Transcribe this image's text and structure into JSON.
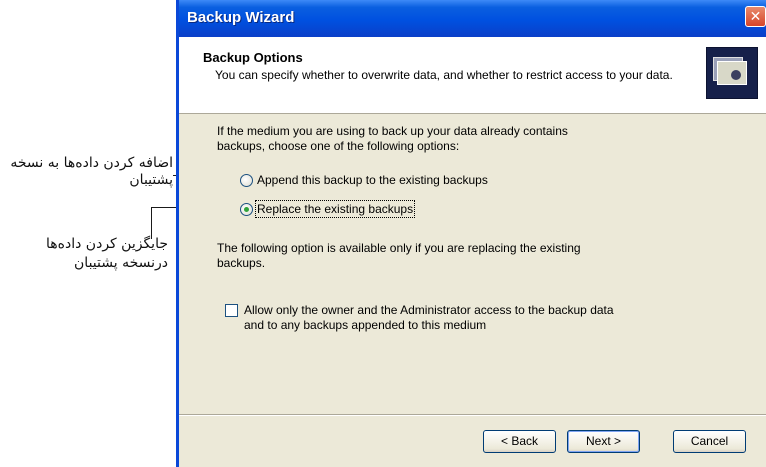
{
  "annotations": {
    "append_note": "اضافه کردن داده‌ها به نسخه پشتیبان",
    "replace_note_line1": "جایگزین کردن داده‌ها",
    "replace_note_line2": "درنسخه پشتیبان"
  },
  "window": {
    "title": "Backup Wizard",
    "close_glyph": "✕"
  },
  "header": {
    "title": "Backup Options",
    "subtitle": "You can specify whether to overwrite data, and whether to restrict access to your data.",
    "icon": "backup-media-icon"
  },
  "content": {
    "intro": "If the medium you are using to back up your data already contains backups, choose one of the following options:",
    "options": [
      {
        "label": "Append this backup to the existing backups",
        "selected": false
      },
      {
        "label": "Replace the existing backups",
        "selected": true
      }
    ],
    "replace_note": "The following option is available only if you are replacing the existing backups.",
    "restrict_checkbox": {
      "label": "Allow only the owner and the Administrator access to the backup data and to any backups appended to this medium",
      "checked": false
    }
  },
  "buttons": {
    "back": "< Back",
    "next": "Next >",
    "cancel": "Cancel"
  },
  "colors": {
    "titlebar": "#0a5fe0",
    "dialog_bg": "#ece9d8",
    "close_button": "#d6452a",
    "radio_dot": "#2fa33a"
  }
}
